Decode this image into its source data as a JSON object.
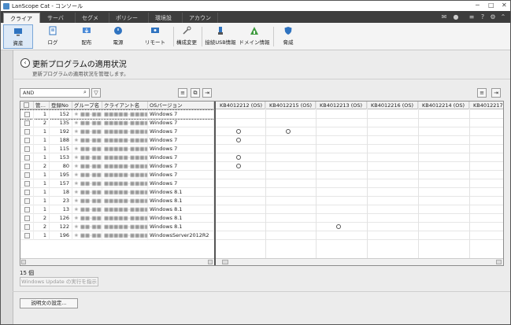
{
  "window": {
    "title": "LanScope Cat - コンソール",
    "min": "─",
    "max": "□",
    "close": "✕"
  },
  "tabs": [
    {
      "label": "クライアント",
      "active": true
    },
    {
      "label": "サーバー"
    },
    {
      "label": "セグメント"
    },
    {
      "label": "ポリシー設定"
    },
    {
      "label": "環境設定"
    },
    {
      "label": "アカウント"
    }
  ],
  "ribbon": [
    {
      "label": "資産",
      "icon": "asset-icon",
      "active": true
    },
    {
      "label": "ログ",
      "icon": "log-icon"
    },
    {
      "label": "配布",
      "icon": "distribution-icon"
    },
    {
      "label": "電源",
      "icon": "power-icon"
    },
    {
      "label": "リモート",
      "icon": "remote-icon"
    },
    {
      "label": "構成変更",
      "icon": "config-icon"
    },
    {
      "label": "接続USB情報",
      "icon": "usb-icon"
    },
    {
      "label": "ドメイン情報",
      "icon": "domain-icon"
    },
    {
      "label": "脅威",
      "icon": "shield-icon"
    }
  ],
  "page": {
    "title": "更新プログラムの適用状況",
    "subtitle": "更新プログラムの適用状況を管理します。"
  },
  "search": {
    "value": "AND"
  },
  "table": {
    "left_headers": [
      "",
      "管…",
      "登録No",
      "グループ名",
      "クライアント名",
      "OSバージョン"
    ],
    "right_headers": [
      "KB4012212 (OS)",
      "KB4012215 (OS)",
      "KB4012213 (OS)",
      "KB4012216 (OS)",
      "KB4012214 (OS)",
      "KB4012217"
    ],
    "rows": [
      {
        "kanri": "1",
        "no": "152",
        "group": "★ ■■-■■■",
        "client": "■■■■■-■■■■",
        "os": "Windows 7",
        "marks": [],
        "selected": true
      },
      {
        "kanri": "2",
        "no": "135",
        "group": "★ ■■-■■■",
        "client": "■■■■■-■■■■",
        "os": "Windows 7",
        "marks": []
      },
      {
        "kanri": "1",
        "no": "192",
        "group": "★ ■■-■■■",
        "client": "■■■■■-■■■■",
        "os": "Windows 7",
        "marks": [
          0,
          1
        ]
      },
      {
        "kanri": "1",
        "no": "188",
        "group": "★ ■■-■■■",
        "client": "■■■■■-■■■■",
        "os": "Windows 7",
        "marks": [
          0
        ]
      },
      {
        "kanri": "1",
        "no": "115",
        "group": "★ ■■-■■■",
        "client": "■■■■■-■■■■",
        "os": "Windows 7",
        "marks": []
      },
      {
        "kanri": "1",
        "no": "153",
        "group": "★ ■■-■■■",
        "client": "■■■■■-■■■■",
        "os": "Windows 7",
        "marks": [
          0
        ]
      },
      {
        "kanri": "2",
        "no": "80",
        "group": "★ ■■-■■■",
        "client": "■■■■■-■■■■",
        "os": "Windows 7",
        "marks": [
          0
        ]
      },
      {
        "kanri": "1",
        "no": "195",
        "group": "★ ■■-■■■",
        "client": "■■■■■-■■■■",
        "os": "Windows 7",
        "marks": []
      },
      {
        "kanri": "1",
        "no": "157",
        "group": "★ ■■-■■■",
        "client": "■■■■■-■■■■",
        "os": "Windows 7",
        "marks": []
      },
      {
        "kanri": "1",
        "no": "18",
        "group": "★ ■■-■■■",
        "client": "■■■■■-■■■■",
        "os": "Windows 8.1",
        "marks": []
      },
      {
        "kanri": "1",
        "no": "23",
        "group": "★ ■■-■■■",
        "client": "■■■■■-■■■■",
        "os": "Windows 8.1",
        "marks": []
      },
      {
        "kanri": "1",
        "no": "13",
        "group": "★ ■■-■■■",
        "client": "■■■■■-■■■■",
        "os": "Windows 8.1",
        "marks": []
      },
      {
        "kanri": "2",
        "no": "126",
        "group": "★ ■■-■■■",
        "client": "■■■■■-■■■■",
        "os": "Windows 8.1",
        "marks": []
      },
      {
        "kanri": "2",
        "no": "122",
        "group": "★ ■■-■■■",
        "client": "■■■■■-■■■■",
        "os": "Windows 8.1",
        "marks": [
          2
        ]
      },
      {
        "kanri": "1",
        "no": "196",
        "group": "★ ■■-■■■",
        "client": "■■■■■-■■■■",
        "os": "WindowsServer2012R2",
        "marks": []
      }
    ]
  },
  "count_label": "15 個",
  "wu_button": "Windows Update の実行を指示",
  "settings_button": "説明文の設定..."
}
